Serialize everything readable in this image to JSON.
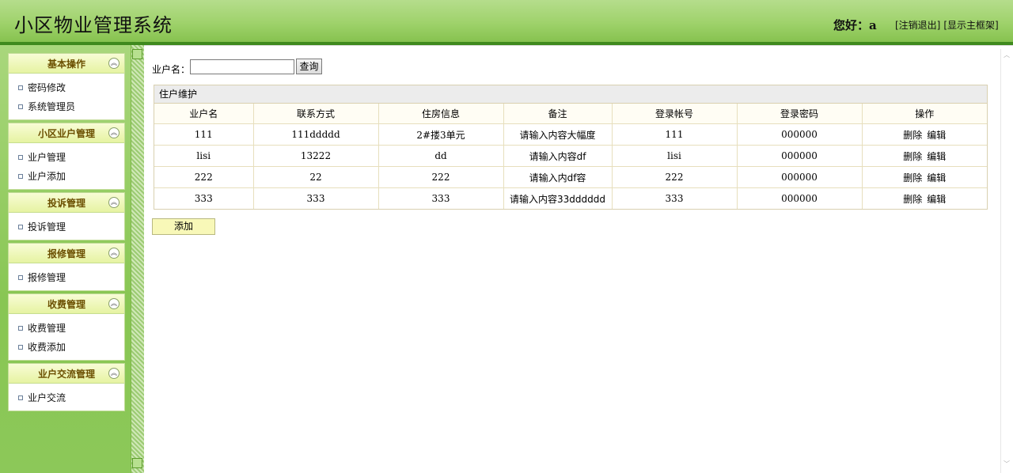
{
  "header": {
    "title": "小区物业管理系统",
    "greeting": "您好：a",
    "logout": "[注销退出]",
    "show_frame": "[显示主框架]"
  },
  "sidebar": {
    "panels": [
      {
        "title": "基本操作",
        "items": [
          "密码修改",
          "系统管理员"
        ]
      },
      {
        "title": "小区业户管理",
        "items": [
          "业户管理",
          "业户添加"
        ]
      },
      {
        "title": "投诉管理",
        "items": [
          "投诉管理"
        ]
      },
      {
        "title": "报修管理",
        "items": [
          "报修管理"
        ]
      },
      {
        "title": "收费管理",
        "items": [
          "收费管理",
          "收费添加"
        ]
      },
      {
        "title": "业户交流管理",
        "items": [
          "业户交流"
        ]
      }
    ]
  },
  "search": {
    "label": "业户名：",
    "value": "",
    "button": "查询"
  },
  "table": {
    "caption": "住户维护",
    "columns": [
      "业户名",
      "联系方式",
      "住房信息",
      "备注",
      "登录帐号",
      "登录密码",
      "操作"
    ],
    "rows": [
      [
        "111",
        "111ddddd",
        "2#搂3单元",
        "请输入内容大幅度",
        "111",
        "000000"
      ],
      [
        "lisi",
        "13222",
        "dd",
        "请输入内容df",
        "lisi",
        "000000"
      ],
      [
        "222",
        "22",
        "222",
        "请输入内df容",
        "222",
        "000000"
      ],
      [
        "333",
        "333",
        "333",
        "请输入内容33dddddd",
        "333",
        "000000"
      ]
    ],
    "delete_label": "删除",
    "edit_label": "编辑"
  },
  "add_button": "添加",
  "colors": {
    "header_green": "#9fd26b",
    "header_border": "#3f8a1e",
    "sidebar_green": "#88c653",
    "panel_title": "#6b4f00",
    "add_button_bg": "#f8f8b8"
  }
}
